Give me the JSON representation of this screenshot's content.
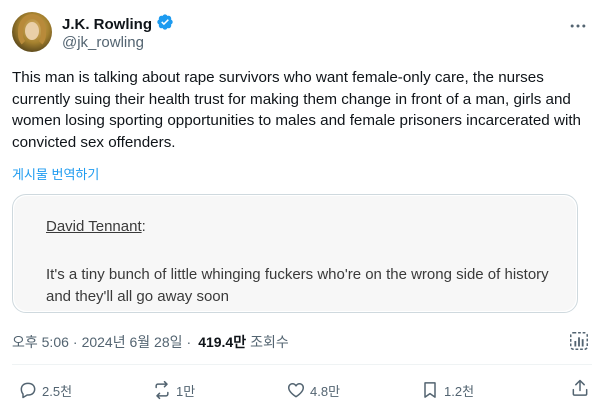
{
  "author": {
    "name": "J.K. Rowling",
    "handle": "@jk_rowling",
    "verified": true
  },
  "post": {
    "text": "This man is talking about rape survivors who want female-only care, the nurses currently suing their health trust for making them change in front of a man, girls and women losing sporting opportunities to males and female prisoners incarcerated with convicted sex offenders.",
    "translate_label": "게시물 번역하기"
  },
  "quote_image": {
    "speaker": "David Tennant",
    "speaker_suffix": ":",
    "text": "It's a tiny bunch of little whinging fuckers who're on the wrong side of history and they'll all go away soon"
  },
  "meta": {
    "time": "오후 5:06",
    "separator": "·",
    "date": "2024년 6월 28일",
    "views": "419.4만",
    "views_label": "조회수"
  },
  "actions": {
    "replies": "2.5천",
    "reposts": "1만",
    "likes": "4.8만",
    "bookmarks": "1.2천"
  },
  "colors": {
    "accent": "#1d9bf0",
    "secondary_text": "#536471",
    "verified": "#1d9bf0"
  },
  "icons": [
    "verified-badge-icon",
    "more-icon",
    "analytics-icon",
    "reply-icon",
    "repost-icon",
    "like-icon",
    "bookmark-icon",
    "share-icon"
  ]
}
